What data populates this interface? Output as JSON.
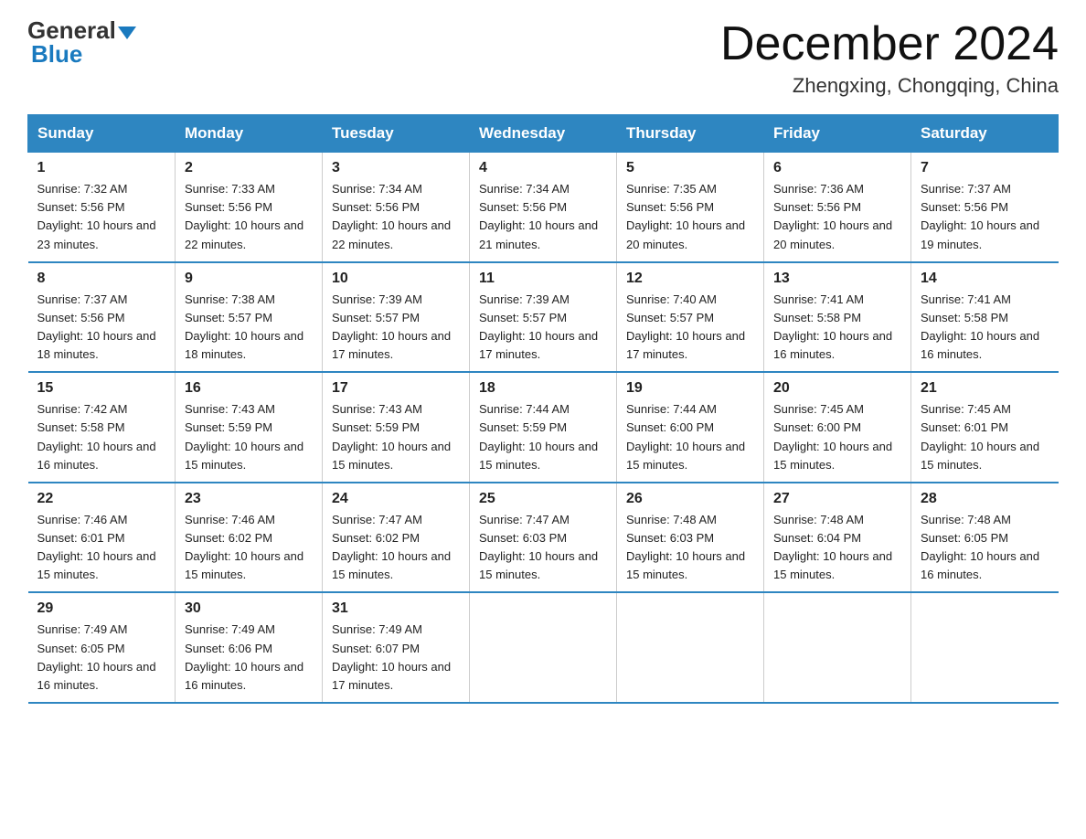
{
  "logo": {
    "general": "General",
    "blue": "Blue"
  },
  "header": {
    "title": "December 2024",
    "location": "Zhengxing, Chongqing, China"
  },
  "days_of_week": [
    "Sunday",
    "Monday",
    "Tuesday",
    "Wednesday",
    "Thursday",
    "Friday",
    "Saturday"
  ],
  "weeks": [
    [
      {
        "day": "1",
        "sunrise": "7:32 AM",
        "sunset": "5:56 PM",
        "daylight": "10 hours and 23 minutes."
      },
      {
        "day": "2",
        "sunrise": "7:33 AM",
        "sunset": "5:56 PM",
        "daylight": "10 hours and 22 minutes."
      },
      {
        "day": "3",
        "sunrise": "7:34 AM",
        "sunset": "5:56 PM",
        "daylight": "10 hours and 22 minutes."
      },
      {
        "day": "4",
        "sunrise": "7:34 AM",
        "sunset": "5:56 PM",
        "daylight": "10 hours and 21 minutes."
      },
      {
        "day": "5",
        "sunrise": "7:35 AM",
        "sunset": "5:56 PM",
        "daylight": "10 hours and 20 minutes."
      },
      {
        "day": "6",
        "sunrise": "7:36 AM",
        "sunset": "5:56 PM",
        "daylight": "10 hours and 20 minutes."
      },
      {
        "day": "7",
        "sunrise": "7:37 AM",
        "sunset": "5:56 PM",
        "daylight": "10 hours and 19 minutes."
      }
    ],
    [
      {
        "day": "8",
        "sunrise": "7:37 AM",
        "sunset": "5:56 PM",
        "daylight": "10 hours and 18 minutes."
      },
      {
        "day": "9",
        "sunrise": "7:38 AM",
        "sunset": "5:57 PM",
        "daylight": "10 hours and 18 minutes."
      },
      {
        "day": "10",
        "sunrise": "7:39 AM",
        "sunset": "5:57 PM",
        "daylight": "10 hours and 17 minutes."
      },
      {
        "day": "11",
        "sunrise": "7:39 AM",
        "sunset": "5:57 PM",
        "daylight": "10 hours and 17 minutes."
      },
      {
        "day": "12",
        "sunrise": "7:40 AM",
        "sunset": "5:57 PM",
        "daylight": "10 hours and 17 minutes."
      },
      {
        "day": "13",
        "sunrise": "7:41 AM",
        "sunset": "5:58 PM",
        "daylight": "10 hours and 16 minutes."
      },
      {
        "day": "14",
        "sunrise": "7:41 AM",
        "sunset": "5:58 PM",
        "daylight": "10 hours and 16 minutes."
      }
    ],
    [
      {
        "day": "15",
        "sunrise": "7:42 AM",
        "sunset": "5:58 PM",
        "daylight": "10 hours and 16 minutes."
      },
      {
        "day": "16",
        "sunrise": "7:43 AM",
        "sunset": "5:59 PM",
        "daylight": "10 hours and 15 minutes."
      },
      {
        "day": "17",
        "sunrise": "7:43 AM",
        "sunset": "5:59 PM",
        "daylight": "10 hours and 15 minutes."
      },
      {
        "day": "18",
        "sunrise": "7:44 AM",
        "sunset": "5:59 PM",
        "daylight": "10 hours and 15 minutes."
      },
      {
        "day": "19",
        "sunrise": "7:44 AM",
        "sunset": "6:00 PM",
        "daylight": "10 hours and 15 minutes."
      },
      {
        "day": "20",
        "sunrise": "7:45 AM",
        "sunset": "6:00 PM",
        "daylight": "10 hours and 15 minutes."
      },
      {
        "day": "21",
        "sunrise": "7:45 AM",
        "sunset": "6:01 PM",
        "daylight": "10 hours and 15 minutes."
      }
    ],
    [
      {
        "day": "22",
        "sunrise": "7:46 AM",
        "sunset": "6:01 PM",
        "daylight": "10 hours and 15 minutes."
      },
      {
        "day": "23",
        "sunrise": "7:46 AM",
        "sunset": "6:02 PM",
        "daylight": "10 hours and 15 minutes."
      },
      {
        "day": "24",
        "sunrise": "7:47 AM",
        "sunset": "6:02 PM",
        "daylight": "10 hours and 15 minutes."
      },
      {
        "day": "25",
        "sunrise": "7:47 AM",
        "sunset": "6:03 PM",
        "daylight": "10 hours and 15 minutes."
      },
      {
        "day": "26",
        "sunrise": "7:48 AM",
        "sunset": "6:03 PM",
        "daylight": "10 hours and 15 minutes."
      },
      {
        "day": "27",
        "sunrise": "7:48 AM",
        "sunset": "6:04 PM",
        "daylight": "10 hours and 15 minutes."
      },
      {
        "day": "28",
        "sunrise": "7:48 AM",
        "sunset": "6:05 PM",
        "daylight": "10 hours and 16 minutes."
      }
    ],
    [
      {
        "day": "29",
        "sunrise": "7:49 AM",
        "sunset": "6:05 PM",
        "daylight": "10 hours and 16 minutes."
      },
      {
        "day": "30",
        "sunrise": "7:49 AM",
        "sunset": "6:06 PM",
        "daylight": "10 hours and 16 minutes."
      },
      {
        "day": "31",
        "sunrise": "7:49 AM",
        "sunset": "6:07 PM",
        "daylight": "10 hours and 17 minutes."
      },
      null,
      null,
      null,
      null
    ]
  ],
  "labels": {
    "sunrise_prefix": "Sunrise: ",
    "sunset_prefix": "Sunset: ",
    "daylight_prefix": "Daylight: "
  }
}
